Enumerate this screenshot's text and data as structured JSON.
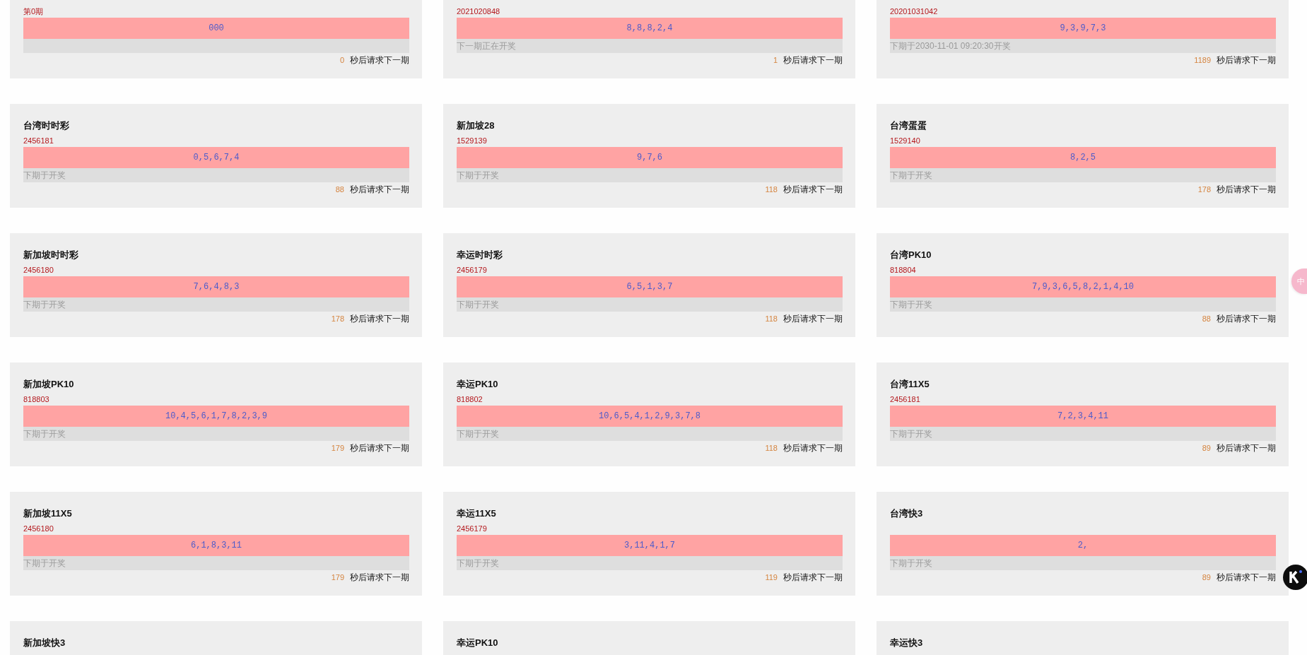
{
  "cards": [
    {
      "issue": "第0期",
      "result": "000",
      "countdown": "0",
      "countdown_label": "秒后请求下一期"
    },
    {
      "issue": "2021020848",
      "result": "8,8,8,2,4",
      "next_draw": "下一期正在开奖",
      "countdown": "1",
      "countdown_label": "秒后请求下一期"
    },
    {
      "issue": "20201031042",
      "result": "9,3,9,7,3",
      "next_draw": "下期于2030-11-01 09:20:30开奖",
      "countdown": "1189",
      "countdown_label": "秒后请求下一期"
    },
    {
      "title": "台湾时时彩",
      "issue": "2456181",
      "result": "0,5,6,7,4",
      "next_draw": "下期于开奖",
      "countdown": "88",
      "countdown_label": "秒后请求下一期"
    },
    {
      "title": "新加坡28",
      "issue": "1529139",
      "result": "9,7,6",
      "next_draw": "下期于开奖",
      "countdown": "118",
      "countdown_label": "秒后请求下一期"
    },
    {
      "title": "台湾蛋蛋",
      "issue": "1529140",
      "result": "8,2,5",
      "next_draw": "下期于开奖",
      "countdown": "178",
      "countdown_label": "秒后请求下一期"
    },
    {
      "title": "新加坡时时彩",
      "issue": "2456180",
      "result": "7,6,4,8,3",
      "next_draw": "下期于开奖",
      "countdown": "178",
      "countdown_label": "秒后请求下一期"
    },
    {
      "title": "幸运时时彩",
      "issue": "2456179",
      "result": "6,5,1,3,7",
      "next_draw": "下期于开奖",
      "countdown": "118",
      "countdown_label": "秒后请求下一期"
    },
    {
      "title": "台湾PK10",
      "issue": "818804",
      "result": "7,9,3,6,5,8,2,1,4,10",
      "next_draw": "下期于开奖",
      "countdown": "88",
      "countdown_label": "秒后请求下一期"
    },
    {
      "title": "新加坡PK10",
      "issue": "818803",
      "result": "10,4,5,6,1,7,8,2,3,9",
      "next_draw": "下期于开奖",
      "countdown": "179",
      "countdown_label": "秒后请求下一期"
    },
    {
      "title": "幸运PK10",
      "issue": "818802",
      "result": "10,6,5,4,1,2,9,3,7,8",
      "next_draw": "下期于开奖",
      "countdown": "118",
      "countdown_label": "秒后请求下一期"
    },
    {
      "title": "台湾11X5",
      "issue": "2456181",
      "result": "7,2,3,4,11",
      "next_draw": "下期于开奖",
      "countdown": "89",
      "countdown_label": "秒后请求下一期"
    },
    {
      "title": "新加坡11X5",
      "issue": "2456180",
      "result": "6,1,8,3,11",
      "next_draw": "下期于开奖",
      "countdown": "179",
      "countdown_label": "秒后请求下一期"
    },
    {
      "title": "幸运11X5",
      "issue": "2456179",
      "result": "3,11,4,1,7",
      "next_draw": "下期于开奖",
      "countdown": "119",
      "countdown_label": "秒后请求下一期"
    },
    {
      "title": "台湾快3",
      "result": "2,",
      "next_draw": "下期于开奖",
      "countdown": "89",
      "countdown_label": "秒后请求下一期"
    },
    {
      "title": "新加坡快3"
    },
    {
      "title": "幸运PK10"
    },
    {
      "title": "幸运快3"
    }
  ],
  "floating_button": {
    "label": "中"
  }
}
